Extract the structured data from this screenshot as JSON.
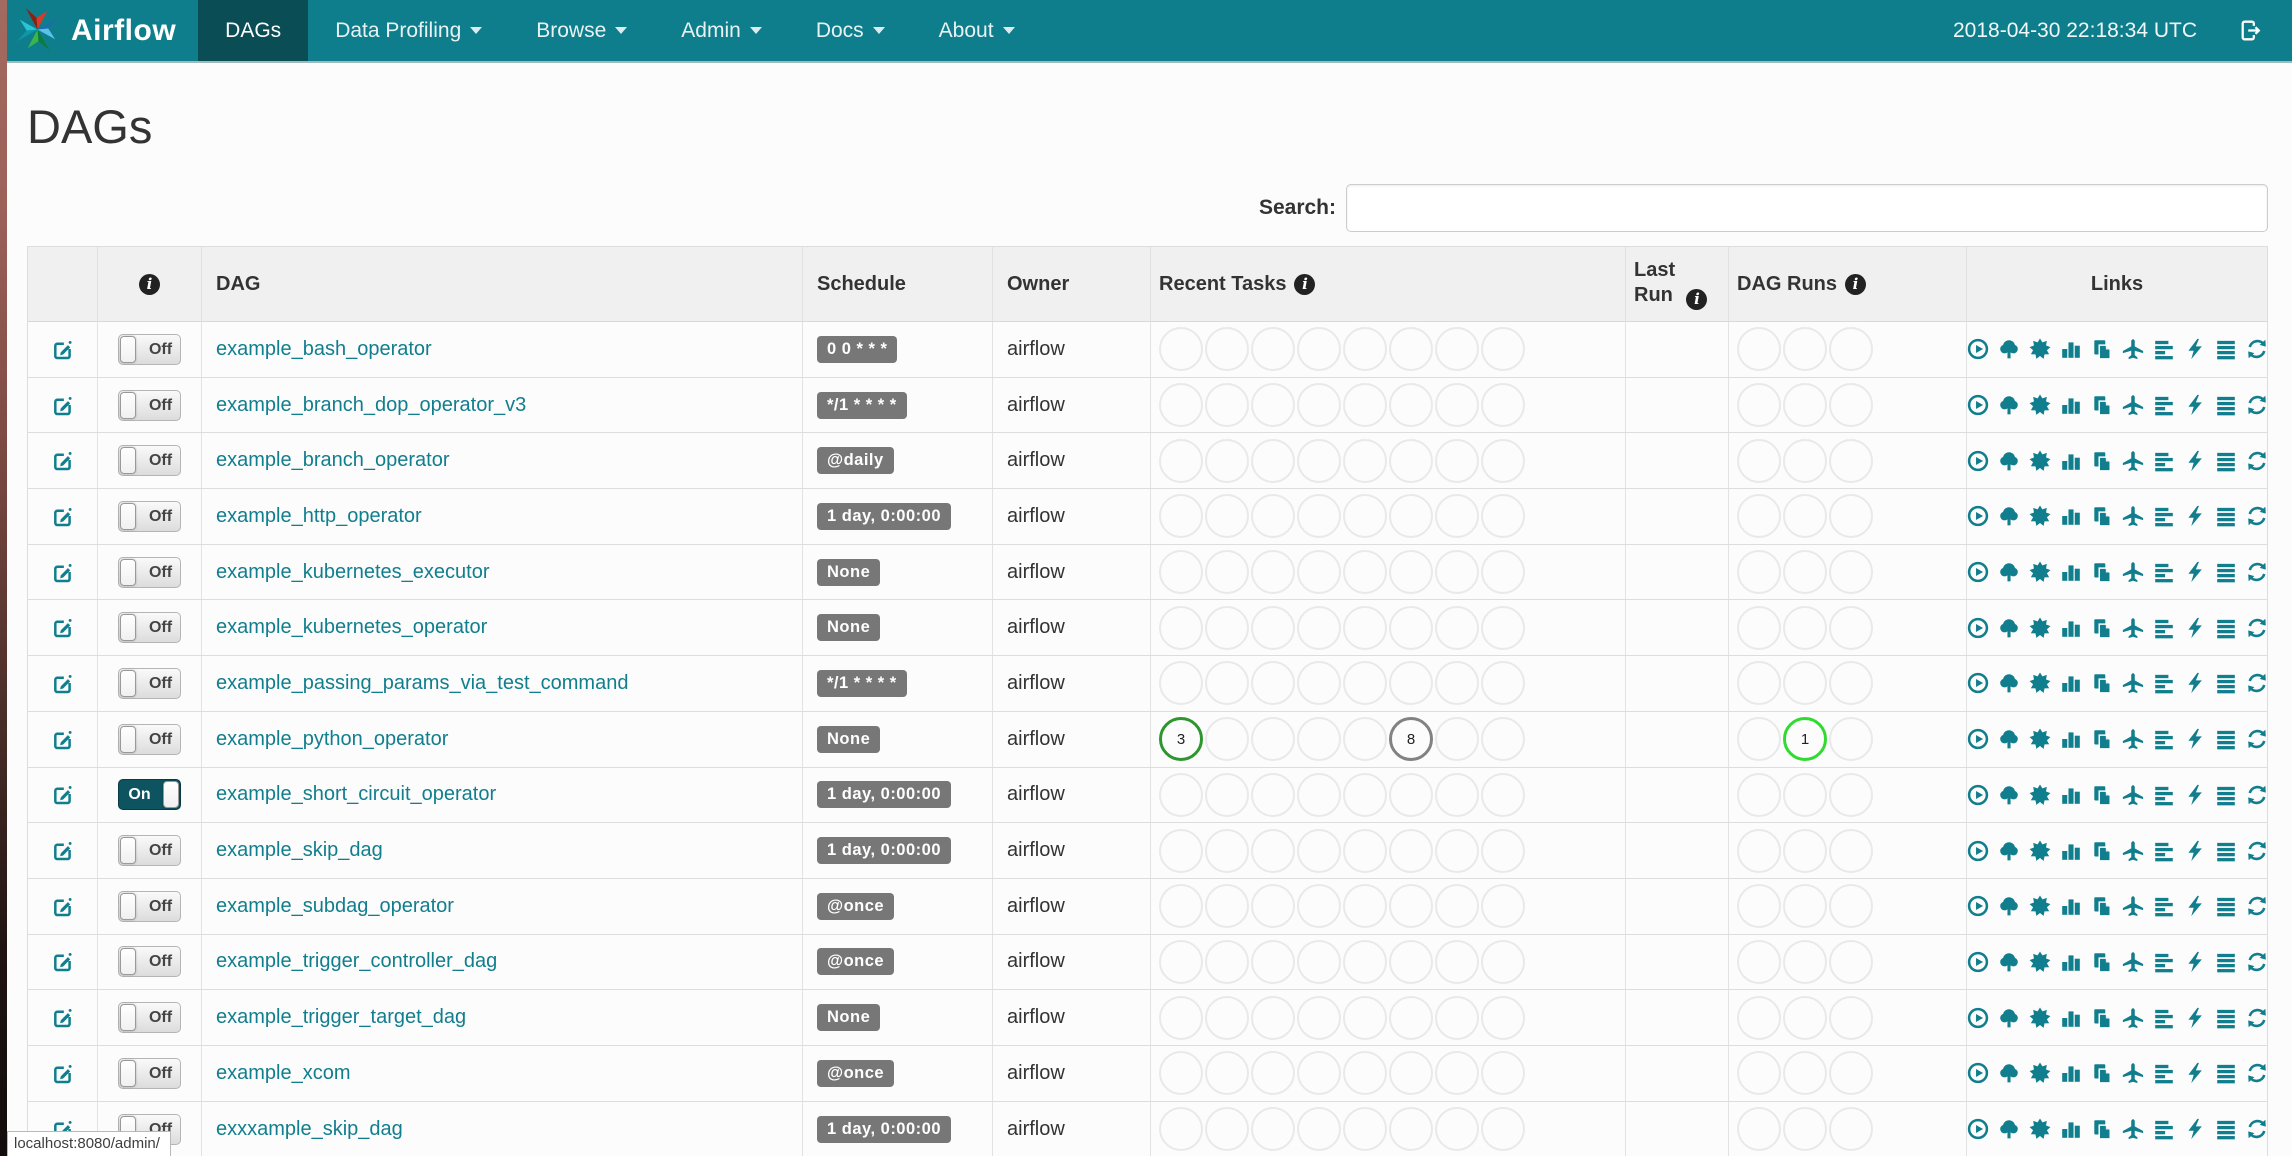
{
  "colors": {
    "navbar": "#0f7e8c",
    "navbar_active": "#0a4d55",
    "link_teal": "#117e8e",
    "badge_gray": "#777777",
    "ring_empty": "#e9e9e9",
    "ring_success": "#2d962d",
    "ring_running": "#31da31",
    "ring_gray": "#828282"
  },
  "navbar": {
    "brand": "Airflow",
    "logo_icon": "airflow-pinwheel",
    "items": [
      {
        "label": "DAGs",
        "active": true,
        "caret": false
      },
      {
        "label": "Data Profiling",
        "active": false,
        "caret": true
      },
      {
        "label": "Browse",
        "active": false,
        "caret": true
      },
      {
        "label": "Admin",
        "active": false,
        "caret": true
      },
      {
        "label": "Docs",
        "active": false,
        "caret": true
      },
      {
        "label": "About",
        "active": false,
        "caret": true
      }
    ],
    "clock": "2018-04-30 22:18:34 UTC",
    "logout_icon": "log-out"
  },
  "page": {
    "title": "DAGs",
    "search_label": "Search:",
    "search_value": "",
    "status_bar": "localhost:8080/admin/"
  },
  "table": {
    "headers": {
      "toggle_info_icon": "info",
      "dag": "DAG",
      "schedule": "Schedule",
      "owner": "Owner",
      "recent_tasks": "Recent Tasks",
      "last_run_line1": "Last",
      "last_run_line2": "Run",
      "dag_runs": "DAG Runs",
      "links": "Links"
    },
    "recent_task_slots": 8,
    "dag_run_slots": 3,
    "links_icons": [
      "trigger-dag",
      "tree-view",
      "graph-view",
      "task-duration",
      "task-tries",
      "landing-times",
      "gantt-view",
      "code-view",
      "logs",
      "refresh"
    ],
    "rows": [
      {
        "toggle": "Off",
        "dag": "example_bash_operator",
        "schedule": "0 0 * * *",
        "owner": "airflow",
        "last_run": "",
        "recent_tasks": {},
        "dag_runs": {}
      },
      {
        "toggle": "Off",
        "dag": "example_branch_dop_operator_v3",
        "schedule": "*/1 * * * *",
        "owner": "airflow",
        "last_run": "",
        "recent_tasks": {},
        "dag_runs": {}
      },
      {
        "toggle": "Off",
        "dag": "example_branch_operator",
        "schedule": "@daily",
        "owner": "airflow",
        "last_run": "",
        "recent_tasks": {},
        "dag_runs": {}
      },
      {
        "toggle": "Off",
        "dag": "example_http_operator",
        "schedule": "1 day, 0:00:00",
        "owner": "airflow",
        "last_run": "",
        "recent_tasks": {},
        "dag_runs": {}
      },
      {
        "toggle": "Off",
        "dag": "example_kubernetes_executor",
        "schedule": "None",
        "owner": "airflow",
        "last_run": "",
        "recent_tasks": {},
        "dag_runs": {}
      },
      {
        "toggle": "Off",
        "dag": "example_kubernetes_operator",
        "schedule": "None",
        "owner": "airflow",
        "last_run": "",
        "recent_tasks": {},
        "dag_runs": {}
      },
      {
        "toggle": "Off",
        "dag": "example_passing_params_via_test_command",
        "schedule": "*/1 * * * *",
        "owner": "airflow",
        "last_run": "",
        "recent_tasks": {},
        "dag_runs": {}
      },
      {
        "toggle": "Off",
        "dag": "example_python_operator",
        "schedule": "None",
        "owner": "airflow",
        "last_run": "",
        "recent_tasks": {
          "0": {
            "state": "success",
            "count": "3"
          },
          "5": {
            "state": "gray",
            "count": "8"
          }
        },
        "dag_runs": {
          "1": {
            "state": "running",
            "count": "1"
          }
        }
      },
      {
        "toggle": "On",
        "dag": "example_short_circuit_operator",
        "schedule": "1 day, 0:00:00",
        "owner": "airflow",
        "last_run": "",
        "recent_tasks": {},
        "dag_runs": {}
      },
      {
        "toggle": "Off",
        "dag": "example_skip_dag",
        "schedule": "1 day, 0:00:00",
        "owner": "airflow",
        "last_run": "",
        "recent_tasks": {},
        "dag_runs": {}
      },
      {
        "toggle": "Off",
        "dag": "example_subdag_operator",
        "schedule": "@once",
        "owner": "airflow",
        "last_run": "",
        "recent_tasks": {},
        "dag_runs": {}
      },
      {
        "toggle": "Off",
        "dag": "example_trigger_controller_dag",
        "schedule": "@once",
        "owner": "airflow",
        "last_run": "",
        "recent_tasks": {},
        "dag_runs": {}
      },
      {
        "toggle": "Off",
        "dag": "example_trigger_target_dag",
        "schedule": "None",
        "owner": "airflow",
        "last_run": "",
        "recent_tasks": {},
        "dag_runs": {}
      },
      {
        "toggle": "Off",
        "dag": "example_xcom",
        "schedule": "@once",
        "owner": "airflow",
        "last_run": "",
        "recent_tasks": {},
        "dag_runs": {}
      },
      {
        "toggle": "Off",
        "dag": "exxxample_skip_dag",
        "schedule": "1 day, 0:00:00",
        "owner": "airflow",
        "last_run": "",
        "recent_tasks": {},
        "dag_runs": {}
      }
    ]
  }
}
